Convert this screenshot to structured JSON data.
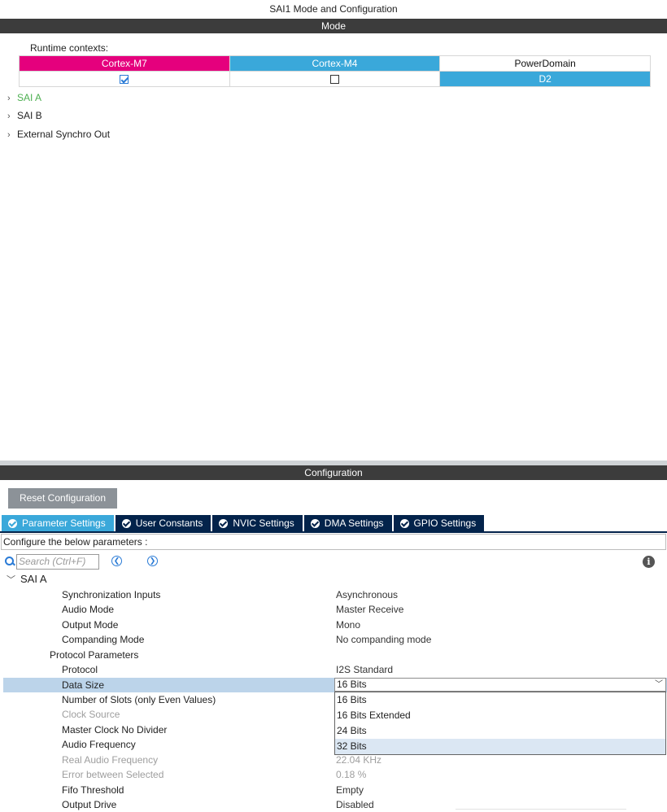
{
  "window": {
    "title": "SAI1 Mode and Configuration"
  },
  "mode_section": {
    "header": "Mode",
    "runtime_label": "Runtime contexts:",
    "contexts": [
      {
        "name": "Cortex-M7",
        "checked": true
      },
      {
        "name": "Cortex-M4",
        "checked": false
      },
      {
        "name": "PowerDomain",
        "value": "D2"
      }
    ],
    "tree": [
      {
        "label": "SAI A",
        "active": true
      },
      {
        "label": "SAI B",
        "active": false
      },
      {
        "label": "External Synchro Out",
        "active": false
      }
    ]
  },
  "config_section": {
    "header": "Configuration",
    "reset_button": "Reset Configuration",
    "tabs": [
      "Parameter Settings",
      "User Constants",
      "NVIC Settings",
      "DMA Settings",
      "GPIO Settings"
    ],
    "active_tab": "Parameter Settings",
    "hint": "Configure the below parameters :",
    "search": {
      "placeholder": "Search (Ctrl+F)",
      "value": ""
    },
    "group": "SAI A",
    "params": [
      {
        "name": "Synchronization Inputs",
        "value": "Asynchronous"
      },
      {
        "name": "Audio Mode",
        "value": "Master Receive"
      },
      {
        "name": "Output Mode",
        "value": "Mono"
      },
      {
        "name": "Companding Mode",
        "value": "No companding mode"
      },
      {
        "name": "Protocol Parameters",
        "value": ""
      },
      {
        "name": "Protocol",
        "value": "I2S Standard"
      },
      {
        "name": "Data Size",
        "value": "16 Bits"
      },
      {
        "name": "Number of Slots (only Even Values)",
        "value": ""
      },
      {
        "name": "Clock Source",
        "value": ""
      },
      {
        "name": "Master Clock No Divider",
        "value": ""
      },
      {
        "name": "Audio Frequency",
        "value": ""
      },
      {
        "name": "Real Audio Frequency",
        "value": "22.04 KHz"
      },
      {
        "name": "Error between Selected",
        "value": "0.18 %"
      },
      {
        "name": "Fifo Threshold",
        "value": "Empty"
      },
      {
        "name": "Output Drive",
        "value": "Disabled"
      }
    ],
    "dropdown": {
      "selected": "16 Bits",
      "options": [
        "16 Bits",
        "16 Bits Extended",
        "24 Bits",
        "32 Bits"
      ],
      "highlighted": "32 Bits"
    }
  },
  "colors": {
    "cortex_m7": "#e5007d",
    "cortex_m4": "#3aa8da",
    "tab_active": "#3aa8da",
    "tab_inactive": "#03234b",
    "header_bg": "#3c3c3c",
    "active_tree": "#4caf50"
  },
  "icons": [
    "checkbox-checked-icon",
    "checkbox-empty-icon",
    "chevron-right-icon",
    "chevron-down-icon",
    "check-circle-icon",
    "search-icon",
    "prev-arrow-icon",
    "next-arrow-icon",
    "info-icon"
  ]
}
